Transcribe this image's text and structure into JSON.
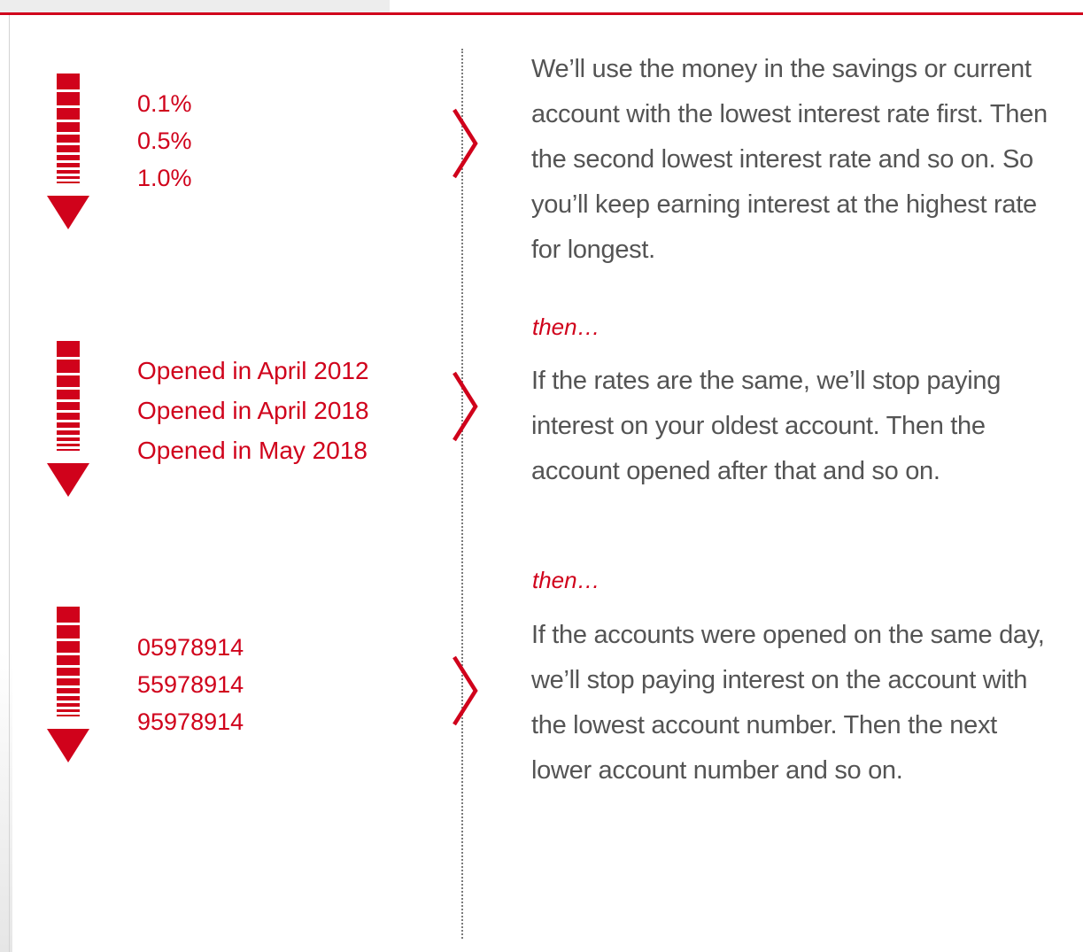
{
  "theme": {
    "accent": "#d0021b",
    "body_text": "#545454",
    "divider": "#7a7a7a"
  },
  "steps": [
    {
      "icon": "down-arrow-icon",
      "examples": [
        "0.1%",
        "0.5%",
        "1.0%"
      ],
      "then_label": "",
      "text": "We’ll use the money in the savings or current account with the lowest interest rate first. Then the second lowest interest rate and so on. So you’ll keep earning interest at the highest rate for longest."
    },
    {
      "icon": "down-arrow-icon",
      "examples": [
        "Opened in April 2012",
        "Opened in April 2018",
        "Opened in May 2018"
      ],
      "then_label": "then…",
      "text": "If the rates are the same, we’ll stop paying interest on your oldest account. Then the account opened after that and so on."
    },
    {
      "icon": "down-arrow-icon",
      "examples": [
        "05978914",
        "55978914",
        "95978914"
      ],
      "then_label": "then…",
      "text": "If the accounts were opened on the same day, we’ll stop paying interest on the account with the lowest account number. Then the next lower account number and so on."
    }
  ]
}
